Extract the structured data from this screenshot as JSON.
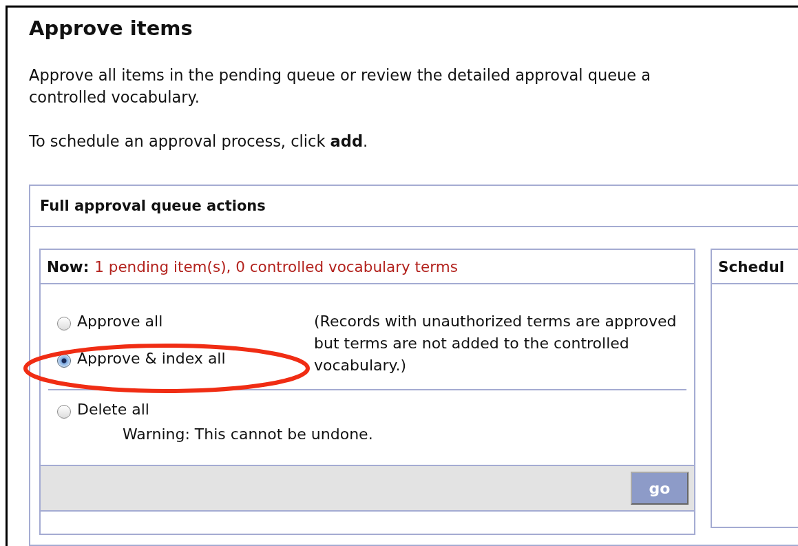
{
  "title": "Approve items",
  "intro_lines": [
    "Approve all items in the pending queue or review the detailed approval queue a",
    "controlled vocabulary."
  ],
  "schedule_hint": "To schedule an approval process, click **add**.",
  "panel": {
    "title": "Full approval queue actions",
    "now_box": {
      "label": "Now:",
      "summary": "1 pending item(s), 0 controlled vocabulary terms",
      "approve_options": [
        {
          "label": "Approve all",
          "selected": false
        },
        {
          "label": "Approve & index all",
          "selected": true
        }
      ],
      "note": "(Records with unauthorized terms are approved but terms are not added to the controlled vocabulary.)",
      "delete_option": {
        "label": "Delete all",
        "selected": false,
        "warning": "Warning: This cannot be undone."
      },
      "button": "go"
    },
    "schedule_box": {
      "title": "Schedul"
    }
  }
}
